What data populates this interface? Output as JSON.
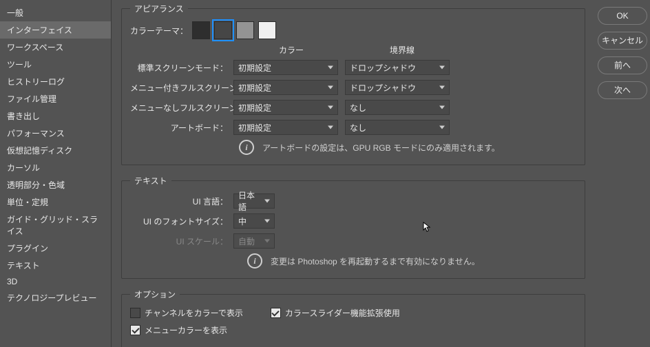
{
  "sidebar": {
    "items": [
      "一般",
      "インターフェイス",
      "ワークスペース",
      "ツール",
      "ヒストリーログ",
      "ファイル管理",
      "書き出し",
      "パフォーマンス",
      "仮想記憶ディスク",
      "カーソル",
      "透明部分・色域",
      "単位・定規",
      "ガイド・グリッド・スライス",
      "プラグイン",
      "テキスト",
      "3D",
      "テクノロジープレビュー"
    ],
    "selected": 1
  },
  "buttons": {
    "ok": "OK",
    "cancel": "キャンセル",
    "prev": "前へ",
    "next": "次へ"
  },
  "appearance": {
    "legend": "アピアランス",
    "color_theme_label": "カラーテーマ：",
    "swatches": [
      "#2e2e2e",
      "#464646",
      "#949494",
      "#f0f0f0"
    ],
    "swatch_selected": 1,
    "header_color": "カラー",
    "header_border": "境界線",
    "rows": [
      {
        "label": "標準スクリーンモード：",
        "color": "初期設定",
        "border": "ドロップシャドウ"
      },
      {
        "label": "メニュー付きフルスクリーン：",
        "color": "初期設定",
        "border": "ドロップシャドウ"
      },
      {
        "label": "メニューなしフルスクリーン：",
        "color": "初期設定",
        "border": "なし"
      },
      {
        "label": "アートボード：",
        "color": "初期設定",
        "border": "なし"
      }
    ],
    "info": "アートボードの設定は、GPU RGB モードにのみ適用されます。"
  },
  "text": {
    "legend": "テキスト",
    "ui_lang_label": "UI 言語：",
    "ui_lang": "日本語",
    "ui_font_label": "UI のフォントサイズ：",
    "ui_font": "中",
    "ui_scale_label": "UI スケール：",
    "ui_scale": "自動",
    "info": "変更は Photoshop を再起動するまで有効になりません。"
  },
  "options": {
    "legend": "オプション",
    "channel_color": "チャンネルをカラーで表示",
    "channel_color_checked": false,
    "color_slider": "カラースライダー機能拡張使用",
    "color_slider_checked": true,
    "menu_color": "メニューカラーを表示",
    "menu_color_checked": true
  }
}
